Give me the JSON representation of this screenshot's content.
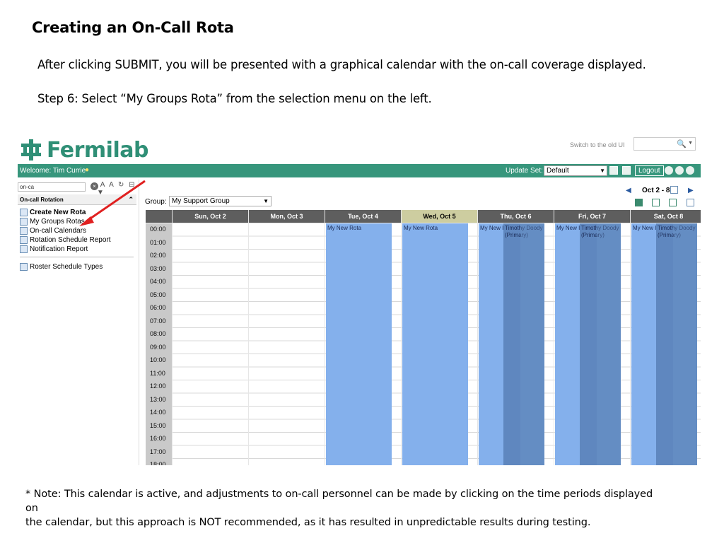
{
  "slide": {
    "title": "Creating an On-Call Rota",
    "para1": "After clicking SUBMIT, you will be presented with a graphical calendar with the on-call coverage displayed.",
    "para2": "Step 6: Select “My Groups Rota” from the selection menu on the left.",
    "note_line1": " * Note: This calendar is active, and adjustments to on-call personnel can be made by clicking on the time periods displayed on",
    "note_line2": "the calendar, but this approach is NOT recommended, as it has resulted in unpredictable results during testing."
  },
  "header": {
    "logo_text": "Fermilab",
    "old_ui_link": "Switch to the old UI",
    "welcome": "Welcome: Tim Currie",
    "update_set_label": "Update Set:",
    "update_set_value": "Default",
    "logout_label": "Logout"
  },
  "nav": {
    "filter_value": "on-ca",
    "section_title": "On-call Rotation",
    "items": [
      {
        "label": "Create New Rota"
      },
      {
        "label": "My Groups Rotas"
      },
      {
        "label": "On-call Calendars"
      },
      {
        "label": "Rotation Schedule Report"
      },
      {
        "label": "Notification Report"
      },
      {
        "label": "Roster Schedule Types"
      }
    ]
  },
  "calendar": {
    "group_label": "Group:",
    "group_value": "My Support Group",
    "range": "Oct 2 - 8",
    "days": [
      "Sun, Oct 2",
      "Mon, Oct 3",
      "Tue, Oct 4",
      "Wed, Oct 5",
      "Thu, Oct 6",
      "Fri, Oct 7",
      "Sat, Oct 8"
    ],
    "today_index": 3,
    "times": [
      "00:00",
      "01:00",
      "02:00",
      "03:00",
      "04:00",
      "05:00",
      "06:00",
      "07:00",
      "08:00",
      "09:00",
      "10:00",
      "11:00",
      "12:00",
      "13:00",
      "14:00",
      "15:00",
      "16:00",
      "17:00",
      "18:00"
    ],
    "event_rota": "My New Rota",
    "event_rota_short": "My New I",
    "event_person": "Timothy Doody (Primary)"
  },
  "colors": {
    "brand_green": "#37967c",
    "event_light": "#84b0ec",
    "event_dark": "#5f87bf",
    "arrow_red": "#e02020"
  }
}
